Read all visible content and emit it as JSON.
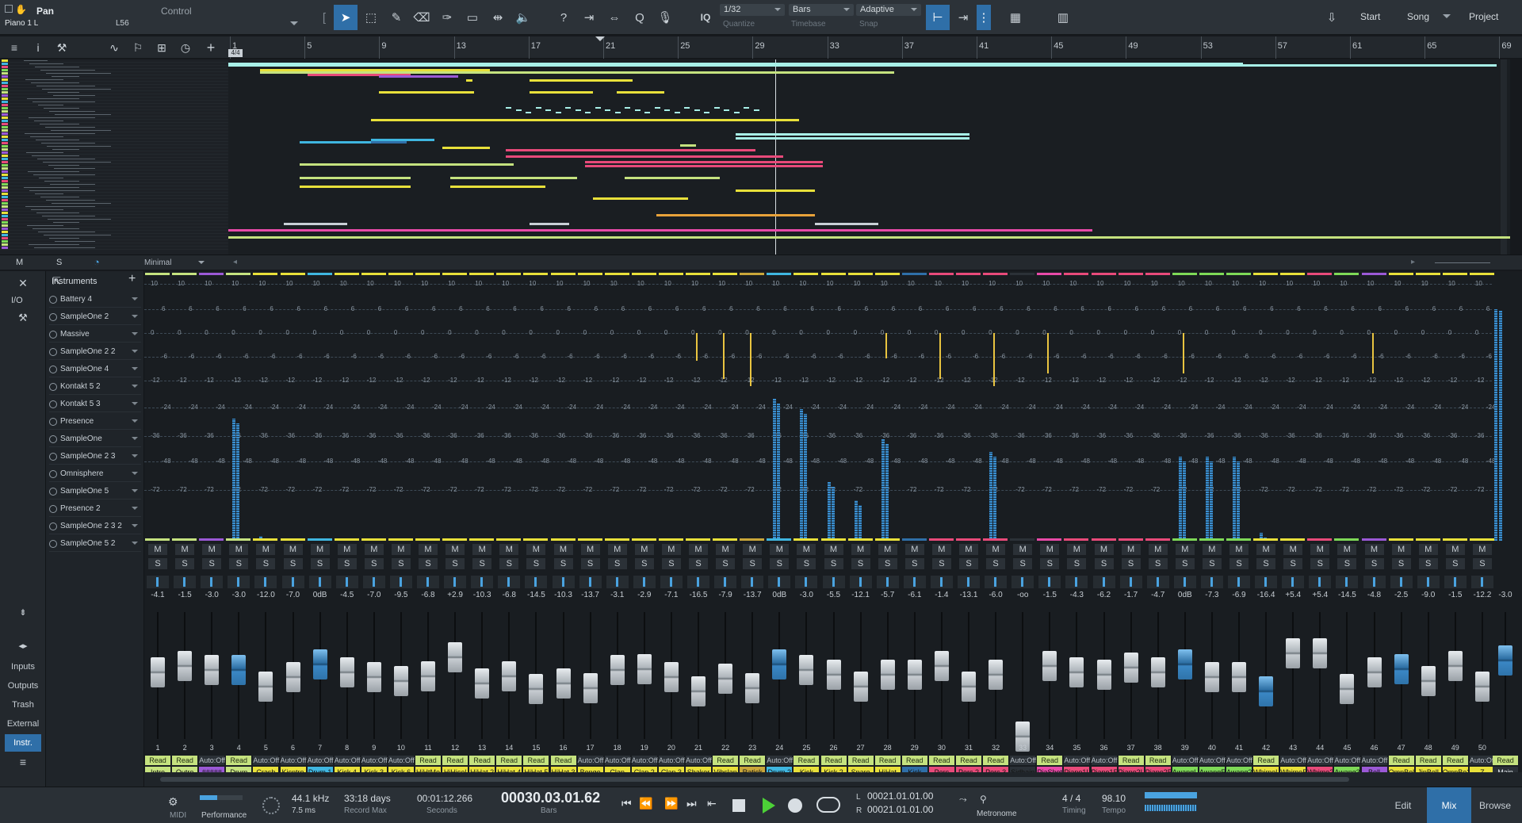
{
  "toolbar": {
    "param_name": "Pan",
    "param_mode": "Control",
    "track_name": "Piano 1 L",
    "track_sel": "L56",
    "quantize": {
      "value": "1/32",
      "label": "Quantize"
    },
    "timebase": {
      "value": "Bars",
      "label": "Timebase"
    },
    "snap": {
      "value": "Adaptive",
      "label": "Snap"
    },
    "iq": "IQ",
    "start": "Start",
    "song": "Song",
    "project": "Project"
  },
  "ruler": {
    "bars": [
      "1",
      "5",
      "9",
      "13",
      "17",
      "21",
      "25",
      "29",
      "33",
      "37",
      "41",
      "45",
      "49",
      "53",
      "57",
      "61",
      "65",
      "69"
    ],
    "sig": "4/4"
  },
  "arrange_footer": {
    "m": "M",
    "s": "S",
    "view": "Minimal"
  },
  "browser": {
    "io": "I/O",
    "items": [
      "Inputs",
      "Outputs",
      "Trash",
      "External",
      "Instr."
    ]
  },
  "instruments": {
    "title": "Instruments",
    "list": [
      "Battery 4",
      "SampleOne 2",
      "Massive",
      "SampleOne 2 2",
      "SampleOne 4",
      "Kontakt 5 2",
      "Kontakt 5 3",
      "Presence",
      "SampleOne",
      "SampleOne 2 3",
      "Omnisphere",
      "SampleOne 5",
      "Presence 2",
      "SampleOne 2 3 2",
      "SampleOne 5 2"
    ]
  },
  "mixer": {
    "scale": [
      "10",
      "6",
      "0",
      "-6",
      "-12",
      "-24",
      "-36",
      "-48",
      "-72"
    ],
    "scale_right": [
      "0",
      "-6",
      "-12",
      "-24",
      "-36",
      "-48",
      "-60"
    ],
    "main_vol": "-3.0",
    "main_name": "Main",
    "main_auto": "Read",
    "channels": [
      {
        "n": "1",
        "vol": "-4.1",
        "name": "Intro",
        "color": "#c5e27f",
        "auto": "Read",
        "fader": 0.62,
        "meter": 0,
        "peak": 0
      },
      {
        "n": "2",
        "vol": "-1.5",
        "name": "Outro",
        "color": "#c5e27f",
        "auto": "Read",
        "fader": 0.67,
        "meter": 0,
        "peak": 0
      },
      {
        "n": "3",
        "vol": "-3.0",
        "name": "#####",
        "color": "#9b59d6",
        "auto": "Auto:Off",
        "fader": 0.64,
        "meter": 0,
        "peak": 0
      },
      {
        "n": "4",
        "vol": "-3.0",
        "name": "Drum",
        "color": "#c5e27f",
        "auto": "Read",
        "fader": 0.64,
        "meter": 0.48,
        "peak": 0,
        "blue": true
      },
      {
        "n": "5",
        "vol": "-12.0",
        "name": "Crash",
        "color": "#e8e03a",
        "auto": "Auto:Off",
        "fader": 0.5,
        "meter": 0.02,
        "peak": 0
      },
      {
        "n": "6",
        "vol": "-7.0",
        "name": "Kicntro",
        "color": "#e8e03a",
        "auto": "Auto:Off",
        "fader": 0.58,
        "meter": 0,
        "peak": 0
      },
      {
        "n": "7",
        "vol": "0dB",
        "name": "Drum 1",
        "color": "#3fb6e0",
        "auto": "Auto:Off",
        "fader": 0.69,
        "meter": 0,
        "peak": 0,
        "blue": true
      },
      {
        "n": "8",
        "vol": "-4.5",
        "name": "Kick 4",
        "color": "#e8e03a",
        "auto": "Auto:Off",
        "fader": 0.62,
        "meter": 0,
        "peak": 0
      },
      {
        "n": "9",
        "vol": "-7.0",
        "name": "Kick 3",
        "color": "#e8e03a",
        "auto": "Auto:Off",
        "fader": 0.58,
        "meter": 0,
        "peak": 0
      },
      {
        "n": "10",
        "vol": "-9.5",
        "name": "Kick 6",
        "color": "#e8e03a",
        "auto": "Auto:Off",
        "fader": 0.55,
        "meter": 0,
        "peak": 0
      },
      {
        "n": "11",
        "vol": "-6.8",
        "name": "HiHtMo",
        "color": "#e8e03a",
        "auto": "Read",
        "fader": 0.59,
        "meter": 0,
        "peak": 0
      },
      {
        "n": "12",
        "vol": "+2.9",
        "name": "HiHicel",
        "color": "#e8e03a",
        "auto": "Read",
        "fader": 0.75,
        "meter": 0,
        "peak": 0
      },
      {
        "n": "13",
        "vol": "-10.3",
        "name": "HiHat 2",
        "color": "#e8e03a",
        "auto": "Read",
        "fader": 0.53,
        "meter": 0,
        "peak": 0
      },
      {
        "n": "14",
        "vol": "-6.8",
        "name": "HiHat 4",
        "color": "#e8e03a",
        "auto": "Read",
        "fader": 0.59,
        "meter": 0,
        "peak": 0
      },
      {
        "n": "15",
        "vol": "-14.5",
        "name": "HiHat 5",
        "color": "#e8e03a",
        "auto": "Read",
        "fader": 0.48,
        "meter": 0,
        "peak": 0
      },
      {
        "n": "16",
        "vol": "-10.3",
        "name": "HiHat 3",
        "color": "#e8e03a",
        "auto": "Read",
        "fader": 0.53,
        "meter": 0,
        "peak": 0
      },
      {
        "n": "17",
        "vol": "-13.7",
        "name": "Bongo",
        "color": "#e8e03a",
        "auto": "Auto:Off",
        "fader": 0.49,
        "meter": 0,
        "peak": 0
      },
      {
        "n": "18",
        "vol": "-3.1",
        "name": "Clap",
        "color": "#e8e03a",
        "auto": "Auto:Off",
        "fader": 0.64,
        "meter": 0,
        "peak": 0
      },
      {
        "n": "19",
        "vol": "-2.9",
        "name": "Clap 2",
        "color": "#e8e03a",
        "auto": "Auto:Off",
        "fader": 0.65,
        "meter": 0,
        "peak": 0
      },
      {
        "n": "20",
        "vol": "-7.1",
        "name": "Clap 3",
        "color": "#e8e03a",
        "auto": "Auto:Off",
        "fader": 0.58,
        "meter": 0,
        "peak": 0
      },
      {
        "n": "21",
        "vol": "-16.5",
        "name": "Shaker",
        "color": "#e8e03a",
        "auto": "Auto:Off",
        "fader": 0.46,
        "meter": 0,
        "peak": 0.22
      },
      {
        "n": "22",
        "vol": "-7.9",
        "name": "Vibslap",
        "color": "#e8e03a",
        "auto": "Read",
        "fader": 0.57,
        "meter": 0,
        "peak": 0.36
      },
      {
        "n": "23",
        "vol": "-13.7",
        "name": "Ratick",
        "color": "#c9a63a",
        "auto": "Read",
        "fader": 0.49,
        "meter": 0,
        "peak": 0.42
      },
      {
        "n": "24",
        "vol": "0dB",
        "name": "Drum 2",
        "color": "#3fb6e0",
        "auto": "Auto:Off",
        "fader": 0.69,
        "meter": 0.56,
        "peak": 0,
        "blue": true
      },
      {
        "n": "25",
        "vol": "-3.0",
        "name": "Kick",
        "color": "#e8e03a",
        "auto": "Read",
        "fader": 0.64,
        "meter": 0.52,
        "peak": 0
      },
      {
        "n": "26",
        "vol": "-5.5",
        "name": "Kick 2",
        "color": "#e8e03a",
        "auto": "Read",
        "fader": 0.6,
        "meter": 0.23,
        "peak": 0
      },
      {
        "n": "27",
        "vol": "-12.1",
        "name": "Snare",
        "color": "#e8e03a",
        "auto": "Read",
        "fader": 0.5,
        "meter": 0.16,
        "peak": 0
      },
      {
        "n": "28",
        "vol": "-5.7",
        "name": "HiHat",
        "color": "#e8e03a",
        "auto": "Read",
        "fader": 0.6,
        "meter": 0.4,
        "peak": 0.2
      },
      {
        "n": "29",
        "vol": "-6.1",
        "name": "Kick",
        "color": "#2f6fa8",
        "auto": "Read",
        "fader": 0.6,
        "meter": 0,
        "peak": 0
      },
      {
        "n": "30",
        "vol": "-1.4",
        "name": "Perc",
        "color": "#e84a7a",
        "auto": "Read",
        "fader": 0.67,
        "meter": 0,
        "peak": 0.36
      },
      {
        "n": "31",
        "vol": "-13.1",
        "name": "Perc 2",
        "color": "#e84a7a",
        "auto": "Read",
        "fader": 0.5,
        "meter": 0,
        "peak": 0
      },
      {
        "n": "32",
        "vol": "-6.0",
        "name": "Perc 3",
        "color": "#e84a7a",
        "auto": "Read",
        "fader": 0.6,
        "meter": 0.35,
        "peak": 0.42
      },
      {
        "n": "33",
        "vol": "-oo",
        "name": "Sidhain",
        "color": "#2b3137",
        "auto": "Auto:Off",
        "fader": 0.08,
        "meter": 0,
        "peak": 0
      },
      {
        "n": "34",
        "vol": "-1.5",
        "name": "PiaShot",
        "color": "#e84aa8",
        "auto": "Read",
        "fader": 0.67,
        "meter": 0,
        "peak": 0.32
      },
      {
        "n": "35",
        "vol": "-4.3",
        "name": "Piano1L",
        "color": "#e84a7a",
        "auto": "Auto:Off",
        "fader": 0.62,
        "meter": 0,
        "peak": 0
      },
      {
        "n": "36",
        "vol": "-6.2",
        "name": "Piano1R",
        "color": "#e84a7a",
        "auto": "Auto:Off",
        "fader": 0.6,
        "meter": 0,
        "peak": 0
      },
      {
        "n": "37",
        "vol": "-1.7",
        "name": "Piano2L",
        "color": "#e84a7a",
        "auto": "Read",
        "fader": 0.66,
        "meter": 0,
        "peak": 0
      },
      {
        "n": "38",
        "vol": "-4.7",
        "name": "Piano2R",
        "color": "#e84a7a",
        "auto": "Read",
        "fader": 0.62,
        "meter": 0,
        "peak": 0
      },
      {
        "n": "39",
        "vol": "0dB",
        "name": "AwangL",
        "color": "#7ed957",
        "auto": "Auto:Off",
        "fader": 0.69,
        "meter": 0.33,
        "peak": 0.32,
        "blue": true
      },
      {
        "n": "40",
        "vol": "-7.3",
        "name": "AwangR",
        "color": "#7ed957",
        "auto": "Auto:Off",
        "fader": 0.58,
        "meter": 0.33,
        "peak": 0
      },
      {
        "n": "41",
        "vol": "-6.9",
        "name": "Awang2",
        "color": "#7ed957",
        "auto": "Auto:Off",
        "fader": 0.58,
        "meter": 0.33,
        "peak": 0
      },
      {
        "n": "42",
        "vol": "-16.4",
        "name": "WhimeL",
        "color": "#e8e03a",
        "auto": "Read",
        "fader": 0.46,
        "meter": 0.03,
        "peak": 0,
        "blue": true
      },
      {
        "n": "43",
        "vol": "+5.4",
        "name": "WhimeR",
        "color": "#e8e03a",
        "auto": "Auto:Off",
        "fader": 0.78,
        "meter": 0,
        "peak": 0
      },
      {
        "n": "44",
        "vol": "+5.4",
        "name": "Whime2",
        "color": "#e84a7a",
        "auto": "Auto:Off",
        "fader": 0.78,
        "meter": 0,
        "peak": 0
      },
      {
        "n": "45",
        "vol": "-14.5",
        "name": "Awang3",
        "color": "#7ed957",
        "auto": "Auto:Off",
        "fader": 0.48,
        "meter": 0,
        "peak": 0
      },
      {
        "n": "46",
        "vol": "-4.8",
        "name": "Bell",
        "color": "#9b59d6",
        "auto": "Auto:Off",
        "fader": 0.62,
        "meter": 0,
        "peak": 0.32
      },
      {
        "n": "47",
        "vol": "-2.5",
        "name": "OmnBel",
        "color": "#e8e03a",
        "auto": "Read",
        "fader": 0.65,
        "meter": 0,
        "peak": 0,
        "blue": true
      },
      {
        "n": "48",
        "vol": "-9.0",
        "name": "JinBell",
        "color": "#e8e03a",
        "auto": "Read",
        "fader": 0.55,
        "meter": 0,
        "peak": 0
      },
      {
        "n": "49",
        "vol": "-1.5",
        "name": "OmnBe2",
        "color": "#e8e03a",
        "auto": "Read",
        "fader": 0.67,
        "meter": 0,
        "peak": 0
      },
      {
        "n": "50",
        "vol": "-12.2",
        "name": "Z",
        "color": "#e8e03a",
        "auto": "Auto:Off",
        "fader": 0.5,
        "meter": 0,
        "peak": 0
      }
    ]
  },
  "transport": {
    "midi": "MIDI",
    "perf": "Performance",
    "rate": "44.1 kHz",
    "latency": "7.5 ms",
    "rec_days": "33:18 days",
    "rec_max": "Record Max",
    "time_sec": "00:01:12.266",
    "sec_lbl": "Seconds",
    "time_bars": "00030.03.01.62",
    "bars_lbl": "Bars",
    "loop_l": "00021.01.01.00",
    "loop_r": "00021.01.01.00",
    "l": "L",
    "r": "R",
    "metronome": "Metronome",
    "timesig": "4 / 4",
    "timing": "Timing",
    "tempo": "98.10",
    "tempo_lbl": "Tempo",
    "edit": "Edit",
    "mix": "Mix",
    "browse": "Browse"
  }
}
